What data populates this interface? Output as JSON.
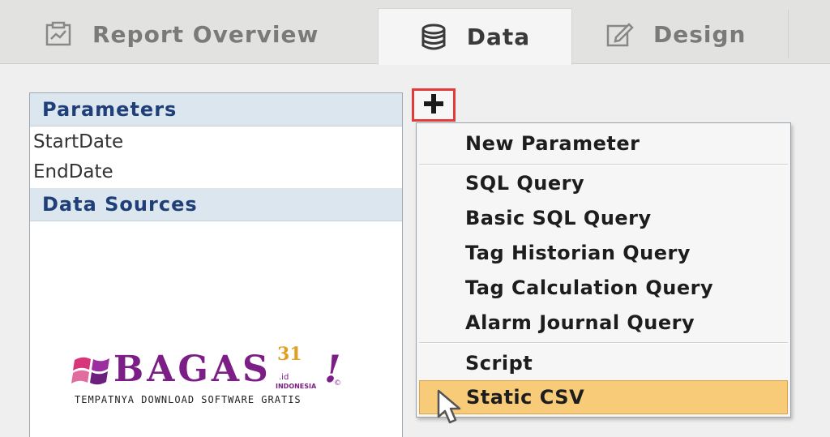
{
  "tabs": [
    {
      "label": "Report Overview",
      "icon": "report-icon",
      "active": false
    },
    {
      "label": "Data",
      "icon": "database-icon",
      "active": true
    },
    {
      "label": "Design",
      "icon": "edit-icon",
      "active": false
    }
  ],
  "left_panel": {
    "parameters_header": "Parameters",
    "parameters": [
      "StartDate",
      "EndDate"
    ],
    "data_sources_header": "Data Sources"
  },
  "add_button": {
    "icon": "plus-icon"
  },
  "menu": {
    "new_parameter": "New Parameter",
    "queries": [
      "SQL Query",
      "Basic SQL Query",
      "Tag Historian Query",
      "Tag Calculation Query",
      "Alarm Journal Query"
    ],
    "script": "Script",
    "static_csv": "Static CSV",
    "highlighted": "Static CSV"
  },
  "watermark": {
    "brand": "BAGAS",
    "number": "31",
    "domain": ".id",
    "country": "INDONESIA",
    "mark": "!",
    "copyright": "©",
    "tagline": "TEMPATNYA DOWNLOAD SOFTWARE GRATIS"
  },
  "colors": {
    "accent_header": "#1f3f78",
    "highlight": "#f8cb79",
    "add_button_border": "#e33a3a",
    "watermark_purple": "#7b1e86",
    "watermark_gold": "#e0a020"
  }
}
